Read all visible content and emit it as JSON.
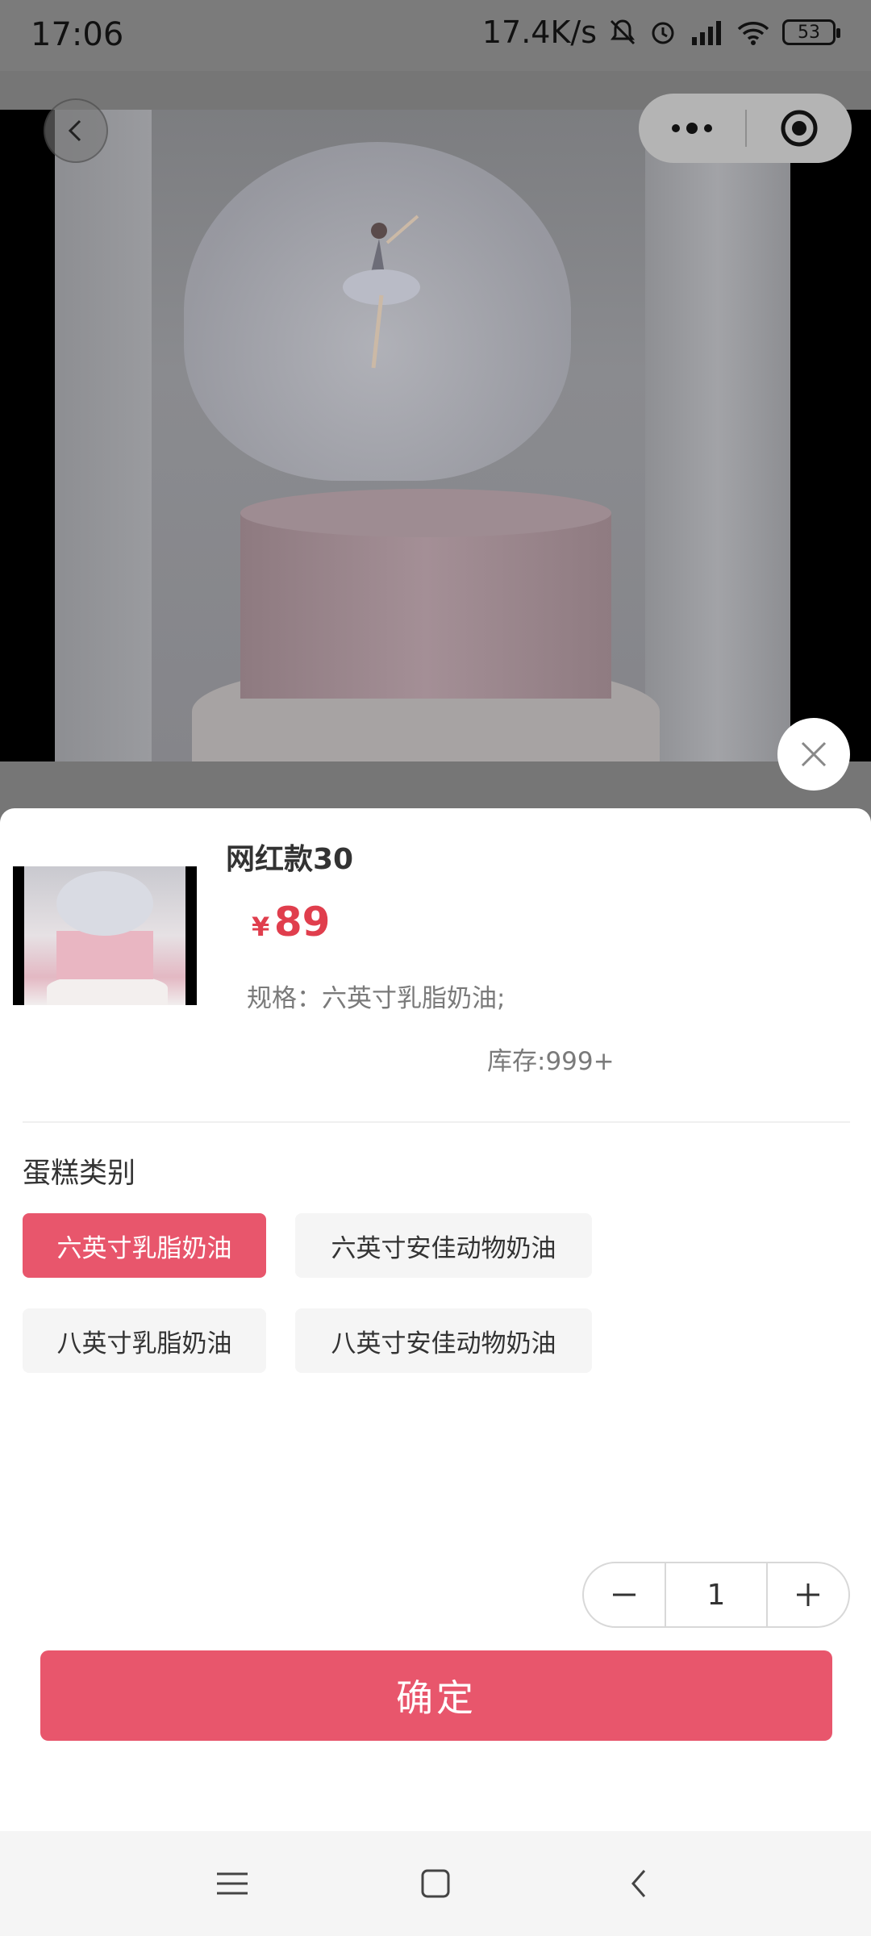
{
  "status_bar": {
    "time": "17:06",
    "net_speed": "17.4K/s",
    "battery": "53",
    "icons": [
      "bell-muted-icon",
      "alarm-icon",
      "signal-icon",
      "wifi-icon",
      "battery-icon"
    ]
  },
  "product": {
    "name": "网红款30",
    "currency": "¥",
    "price": "89",
    "spec": "规格：六英寸乳脂奶油;",
    "stock": "库存:999+"
  },
  "category": {
    "title": "蛋糕类别",
    "options": [
      {
        "label": "六英寸乳脂奶油",
        "selected": true
      },
      {
        "label": "六英寸安佳动物奶油",
        "selected": false
      },
      {
        "label": "八英寸乳脂奶油",
        "selected": false
      },
      {
        "label": "八英寸安佳动物奶油",
        "selected": false
      }
    ]
  },
  "quantity": {
    "value": "1",
    "minus": "−",
    "plus": "+"
  },
  "confirm_label": "确定",
  "colors": {
    "accent": "#e8566c",
    "price": "#e03e4d"
  }
}
